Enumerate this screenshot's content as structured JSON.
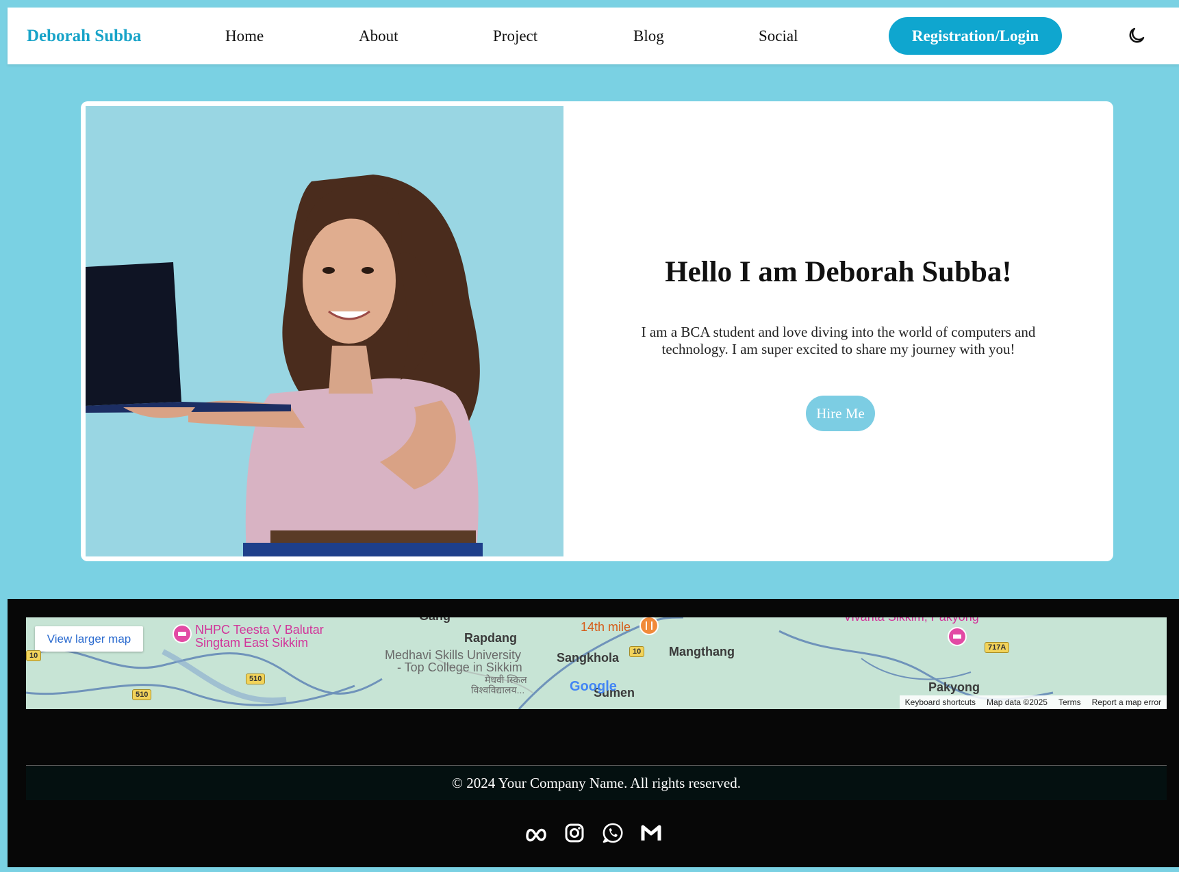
{
  "navbar": {
    "brand": "Deborah Subba",
    "links": [
      "Home",
      "About",
      "Project",
      "Blog",
      "Social"
    ],
    "cta": "Registration/Login",
    "theme_toggle_icon": "moon-icon"
  },
  "hero": {
    "title": "Hello I am Deborah Subba!",
    "description": "I am a BCA student and love diving into the world of computers and technology. I am super excited to share my journey with you!",
    "button": "Hire Me"
  },
  "map": {
    "view_larger": "View larger map",
    "places": {
      "nhpc": "NHPC Teesta V Balutar",
      "nhpc2": "Singtam East Sikkim",
      "rapdang": "Rapdang",
      "medhavi": "Medhavi Skills University",
      "medhavi2": "- Top College in Sikkim",
      "medhavi3": "मेधवी स्किल",
      "medhavi4": "विश्वविद्यालय...",
      "mile14": "14th mile",
      "sangkhola": "Sangkhola",
      "mangthang": "Mangthang",
      "sumen": "Sumen",
      "vivanta": "Vivanta Sikkim, Pakyong",
      "pakyong": "Pakyong",
      "gang": "Gang"
    },
    "shields": {
      "s510a": "510",
      "s510b": "510",
      "s10a": "10",
      "s10b": "10",
      "s717a": "717A"
    },
    "logo": "Google",
    "footer": {
      "shortcuts": "Keyboard shortcuts",
      "mapdata": "Map data ©2025",
      "terms": "Terms",
      "report": "Report a map error"
    }
  },
  "footer": {
    "copyright": "© 2024 Your Company Name. All rights reserved.",
    "socials": [
      "meta-icon",
      "instagram-icon",
      "whatsapp-icon",
      "gmail-icon"
    ]
  },
  "colors": {
    "page_bg": "#7ad1e3",
    "brand": "#17a3c8",
    "cta_bg": "#0fa6cf",
    "hire_bg": "#7ccde3",
    "footer_bg": "#070707"
  }
}
